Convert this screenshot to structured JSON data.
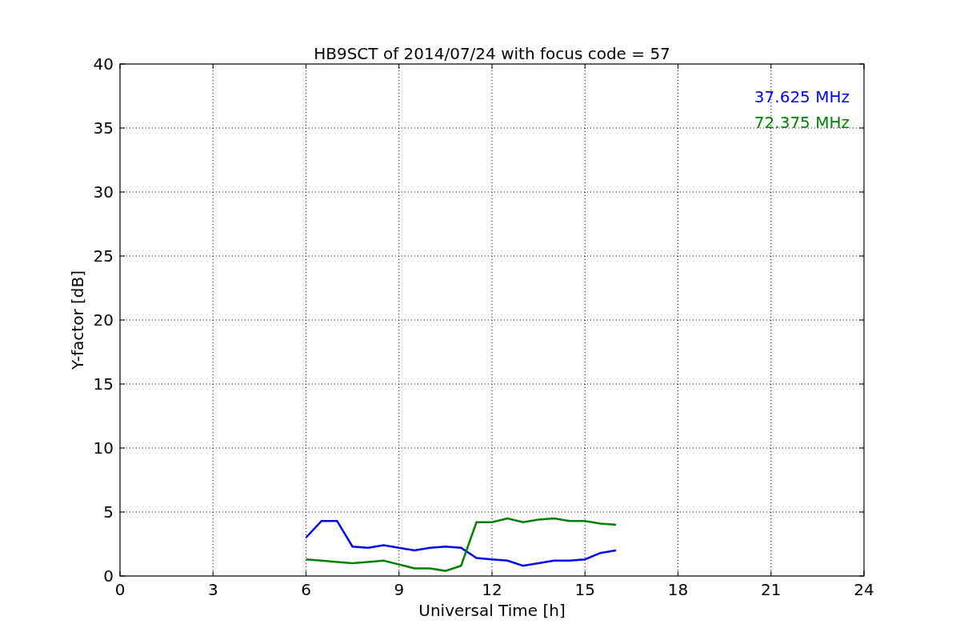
{
  "chart": {
    "chart_data": {
      "type": "line",
      "title": "HB9SCT of 2014/07/24 with focus code = 57",
      "xlabel": "Universal Time [h]",
      "ylabel": "Y-factor [dB]",
      "x": [
        6,
        6.5,
        7,
        7.5,
        8,
        8.5,
        9,
        9.5,
        10,
        10.5,
        11,
        11.5,
        12,
        12.5,
        13,
        13.5,
        14,
        14.5,
        15,
        15.5,
        16
      ],
      "series": [
        {
          "name": "37.625 MHz",
          "color": "#0000ff",
          "values": [
            3.0,
            4.3,
            4.3,
            2.3,
            2.2,
            2.4,
            2.2,
            2.0,
            2.2,
            2.3,
            2.2,
            1.4,
            1.3,
            1.2,
            0.8,
            1.0,
            1.2,
            1.2,
            1.3,
            1.8,
            2.0
          ]
        },
        {
          "name": "72.375 MHz",
          "color": "#008000",
          "values": [
            1.3,
            1.2,
            1.1,
            1.0,
            1.1,
            1.2,
            0.9,
            0.6,
            0.6,
            0.4,
            0.8,
            4.2,
            4.2,
            4.5,
            4.2,
            4.4,
            4.5,
            4.3,
            4.3,
            4.1,
            4.0
          ]
        }
      ],
      "grid": true,
      "xlim": [
        0,
        24
      ],
      "ylim": [
        0,
        40
      ],
      "xticks": [
        0,
        3,
        6,
        9,
        12,
        15,
        18,
        21,
        24
      ],
      "yticks": [
        0,
        5,
        10,
        15,
        20,
        25,
        30,
        35,
        40
      ]
    }
  }
}
